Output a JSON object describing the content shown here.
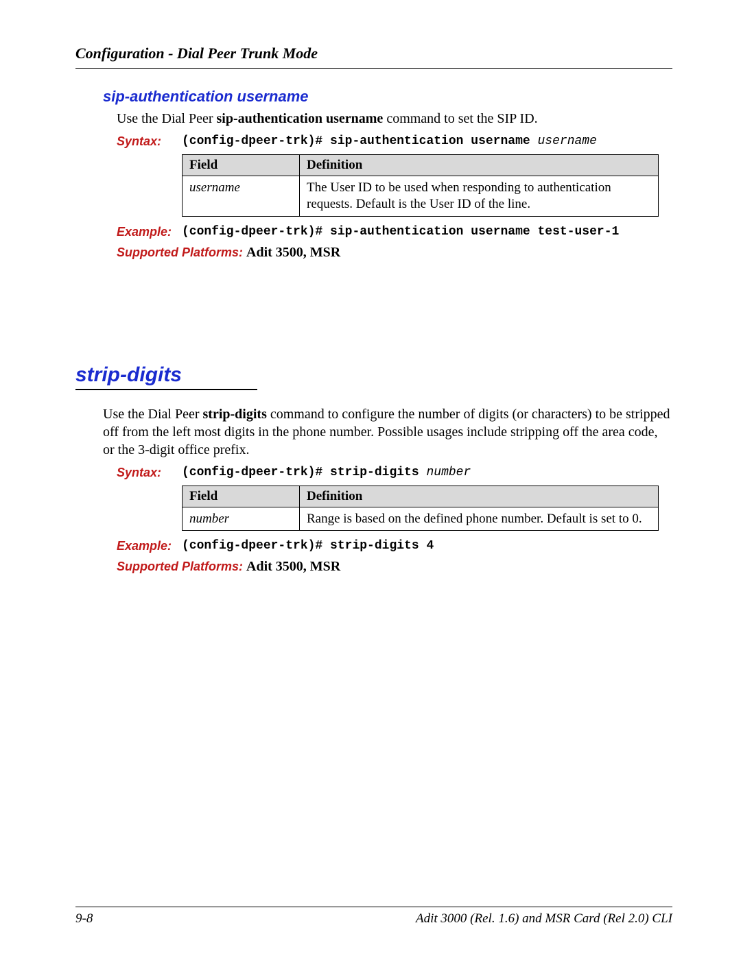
{
  "header": {
    "running_head": "Configuration - Dial Peer Trunk Mode"
  },
  "section1": {
    "title": "sip-authentication username",
    "intro_pre": "Use the Dial Peer ",
    "intro_bold": "sip-authentication username",
    "intro_post": " command to set the SIP ID.",
    "syntax_label": "Syntax:",
    "syntax_cmd": "(config-dpeer-trk)# sip-authentication username ",
    "syntax_arg": "username",
    "table": {
      "h1": "Field",
      "h2": "Definition",
      "r1c1": "username",
      "r1c2": "The User ID to be used when responding to authentication requests. Default is the User ID of the line."
    },
    "example_label": "Example:",
    "example_cmd": "(config-dpeer-trk)# sip-authentication username test-user-1",
    "platforms_label": "Supported Platforms:  ",
    "platforms_val": "Adit 3500, MSR"
  },
  "section2": {
    "heading": "strip-digits",
    "intro_pre": "Use the Dial Peer ",
    "intro_bold": "strip-digits",
    "intro_post": " command to configure the number of digits (or characters) to be stripped off from the left most digits in the phone number. Possible usages include stripping off the area code, or the 3-digit office prefix.",
    "syntax_label": "Syntax:",
    "syntax_cmd": "(config-dpeer-trk)# strip-digits ",
    "syntax_arg": "number",
    "table": {
      "h1": "Field",
      "h2": "Definition",
      "r1c1": "number",
      "r1c2": "Range is based on the defined phone number. Default is set to 0."
    },
    "example_label": "Example:",
    "example_cmd": "(config-dpeer-trk)# strip-digits 4",
    "platforms_label": "Supported Platforms:  ",
    "platforms_val": "Adit 3500, MSR"
  },
  "footer": {
    "page": "9-8",
    "doc": "Adit 3000 (Rel. 1.6) and MSR Card (Rel 2.0) CLI"
  }
}
